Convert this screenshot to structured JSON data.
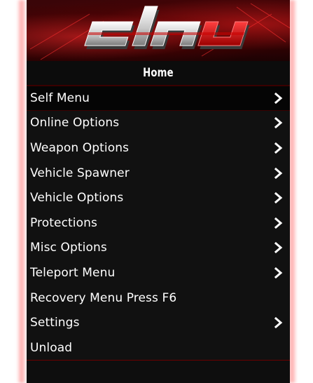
{
  "header": {
    "title": "Home"
  },
  "menu_items": [
    {
      "label": "Self Menu",
      "has_submenu": true,
      "selected": true
    },
    {
      "label": "Online Options",
      "has_submenu": true
    },
    {
      "label": "Weapon Options",
      "has_submenu": true
    },
    {
      "label": "Vehicle Spawner",
      "has_submenu": true
    },
    {
      "label": "Vehicle Options",
      "has_submenu": true
    },
    {
      "label": "Protections",
      "has_submenu": true
    },
    {
      "label": "Misc Options",
      "has_submenu": true
    },
    {
      "label": "Teleport Menu",
      "has_submenu": true
    },
    {
      "label": "Recovery Menu Press F6",
      "has_submenu": false
    },
    {
      "label": "Settings",
      "has_submenu": true
    },
    {
      "label": "Unload",
      "has_submenu": false
    }
  ],
  "icons": {
    "submenu": "chevron-right-icon"
  },
  "colors": {
    "accent": "#cc0000",
    "background": "#111111",
    "text": "#ffffff"
  }
}
